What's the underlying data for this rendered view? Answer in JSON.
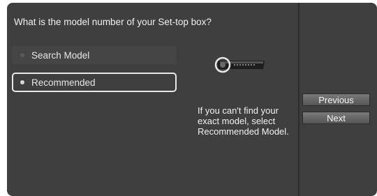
{
  "question": "What is the model number of your Set-top box?",
  "options": [
    {
      "label": "Search Model",
      "selected": false
    },
    {
      "label": "Recommended",
      "selected": true
    }
  ],
  "hint": "If you can't find your exact model, select Recommended Model.",
  "buttons": {
    "previous": "Previous",
    "next": "Next"
  },
  "icons": {
    "device": "set-top-box-icon"
  },
  "colors": {
    "panel": "#3f3f3f",
    "focus_border": "#e8e8e8",
    "button": "#666666"
  }
}
